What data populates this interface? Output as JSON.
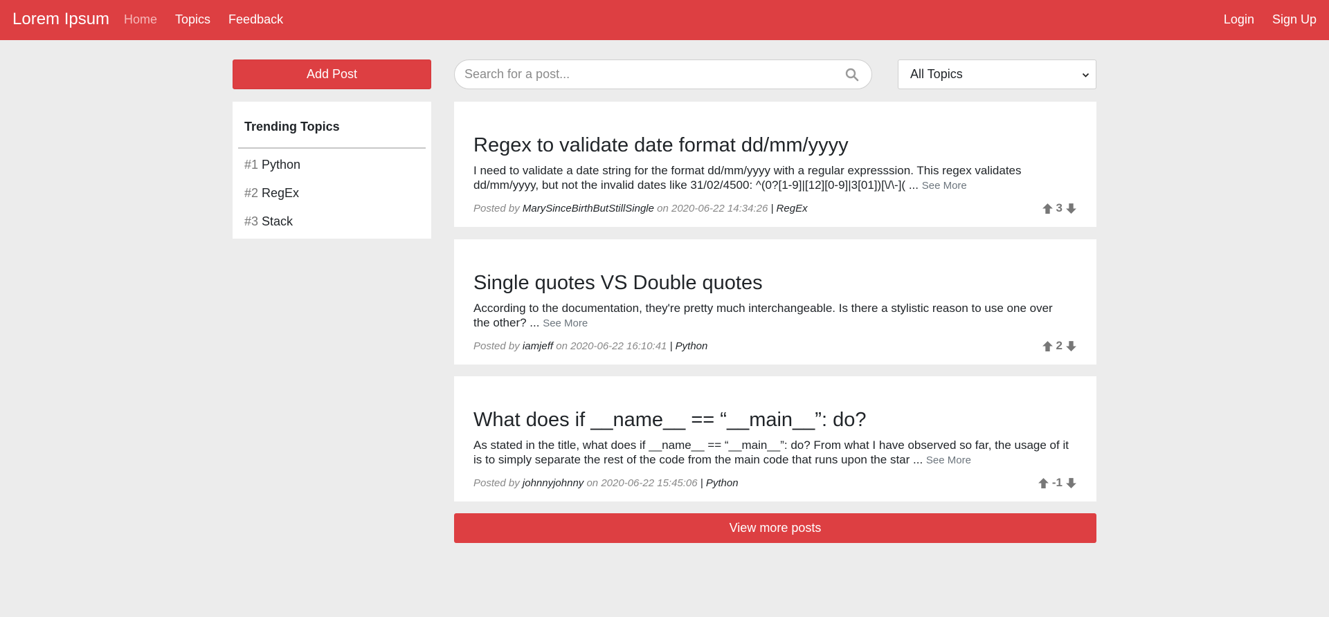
{
  "navbar": {
    "brand": "Lorem Ipsum",
    "links": [
      {
        "label": "Home",
        "active": true
      },
      {
        "label": "Topics"
      },
      {
        "label": "Feedback"
      }
    ],
    "auth": {
      "login": "Login",
      "signup": "Sign Up"
    },
    "color": "#dd3f42"
  },
  "sidebar": {
    "add_post": "Add Post",
    "trending_title": "Trending Topics",
    "topics": [
      {
        "rank": "#1",
        "name": "Python"
      },
      {
        "rank": "#2",
        "name": "RegEx"
      },
      {
        "rank": "#3",
        "name": "Stack"
      }
    ]
  },
  "search": {
    "placeholder": "Search for a post...",
    "icon": "search-icon"
  },
  "filter": {
    "selected": "All Topics"
  },
  "posts": [
    {
      "title": "Regex to validate date format dd/mm/yyyy",
      "excerpt": "I need to validate a date string for the format dd/mm/yyyy with a regular expresssion. This regex validates dd/mm/yyyy, but not the invalid dates like 31/02/4500: ^(0?[1-9]|[12][0-9]|3[01])[\\/\\-]( ...",
      "see_more": "See More",
      "posted_by": "Posted by",
      "author": "MarySinceBirthButStillSingle",
      "on": "on",
      "date": "2020-06-22 14:34:26",
      "sep": "|",
      "topic": "RegEx",
      "votes": "3"
    },
    {
      "title": "Single quotes VS Double quotes",
      "excerpt": "According to the documentation, they're pretty much interchangeable. Is there a stylistic reason to use one over the other? ...",
      "see_more": "See More",
      "posted_by": "Posted by",
      "author": "iamjeff",
      "on": "on",
      "date": "2020-06-22 16:10:41",
      "sep": "|",
      "topic": "Python",
      "votes": "2"
    },
    {
      "title": "What does if __name__ == “__main__”: do?",
      "excerpt": "As stated in the title, what does if __name__ == “__main__”: do? From what I have observed so far, the usage of it is to simply separate the rest of the code from the main code that runs upon the star ...",
      "see_more": "See More",
      "posted_by": "Posted by",
      "author": "johnnyjohnny",
      "on": "on",
      "date": "2020-06-22 15:45:06",
      "sep": "|",
      "topic": "Python",
      "votes": "-1"
    }
  ],
  "view_more": "View more posts"
}
